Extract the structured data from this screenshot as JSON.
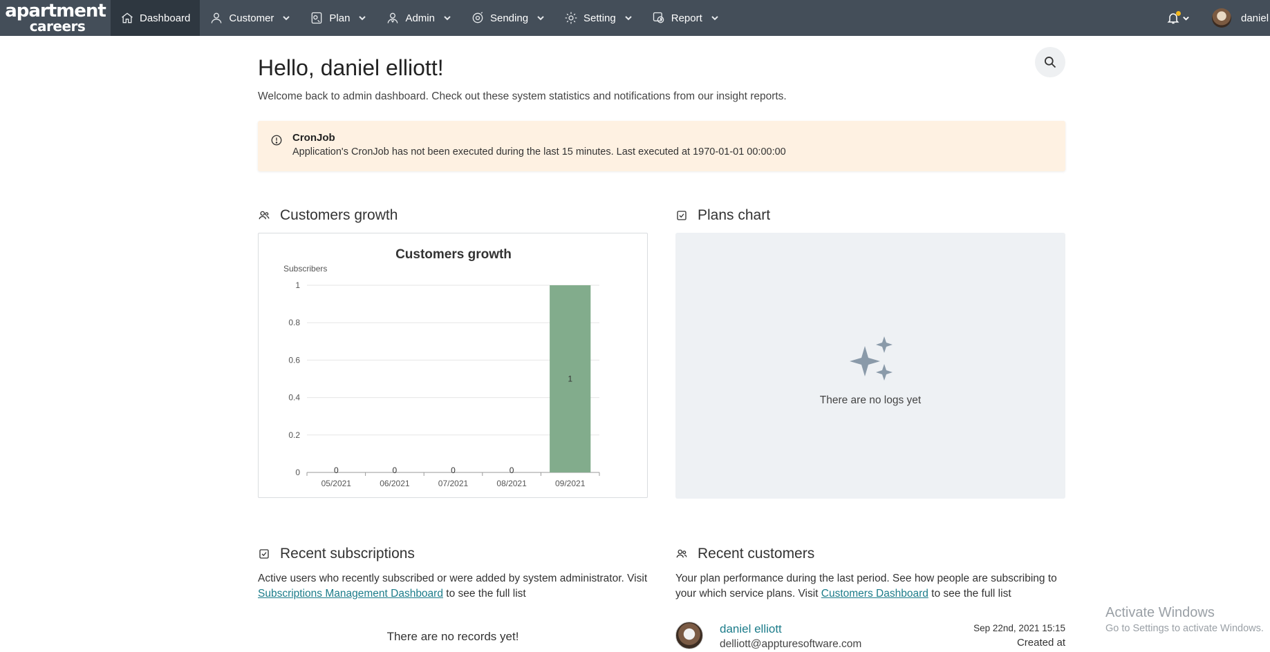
{
  "nav": {
    "logo_line1": "apartment",
    "logo_line2": "careers",
    "items": [
      {
        "label": "Dashboard"
      },
      {
        "label": "Customer"
      },
      {
        "label": "Plan"
      },
      {
        "label": "Admin"
      },
      {
        "label": "Sending"
      },
      {
        "label": "Setting"
      },
      {
        "label": "Report"
      }
    ],
    "user": "daniel"
  },
  "header": {
    "greeting": "Hello, daniel elliott!",
    "welcome": "Welcome back to admin dashboard. Check out these system statistics and notifications from our insight reports."
  },
  "alert": {
    "title": "CronJob",
    "message": "Application's CronJob has not been executed during the last 15 minutes. Last executed at 1970-01-01 00:00:00"
  },
  "sections": {
    "customers_growth": "Customers growth",
    "plans_chart": "Plans chart",
    "plans_empty": "There are no logs yet",
    "recent_subscriptions": "Recent subscriptions",
    "recent_customers": "Recent customers"
  },
  "subscriptions": {
    "desc_before": "Active users who recently subscribed or were added by system administrator. Visit",
    "link": "Subscriptions Management Dashboard",
    "desc_after": "to see the full list",
    "empty": "There are no records yet!"
  },
  "customers": {
    "desc_before": "Your plan performance during the last period. See how people are subscribing to your which service plans. Visit",
    "link": "Customers Dashboard",
    "desc_after": "to see the full list",
    "items": [
      {
        "name": "daniel elliott",
        "email": "delliott@appturesoftware.com",
        "date": "Sep 22nd, 2021 15:15",
        "created_label": "Created at"
      }
    ]
  },
  "windows": {
    "line1": "Activate Windows",
    "line2": "Go to Settings to activate Windows."
  },
  "chart_data": {
    "type": "bar",
    "title": "Customers growth",
    "ylabel": "Subscribers",
    "xlabel": "",
    "categories": [
      "05/2021",
      "06/2021",
      "07/2021",
      "08/2021",
      "09/2021"
    ],
    "values": [
      0,
      0,
      0,
      0,
      1
    ],
    "ylim": [
      0,
      1
    ],
    "yticks": [
      "0",
      "0.2",
      "0.4",
      "0.6",
      "0.8",
      "1"
    ],
    "bar_color": "#82ac8c",
    "grid": true
  }
}
